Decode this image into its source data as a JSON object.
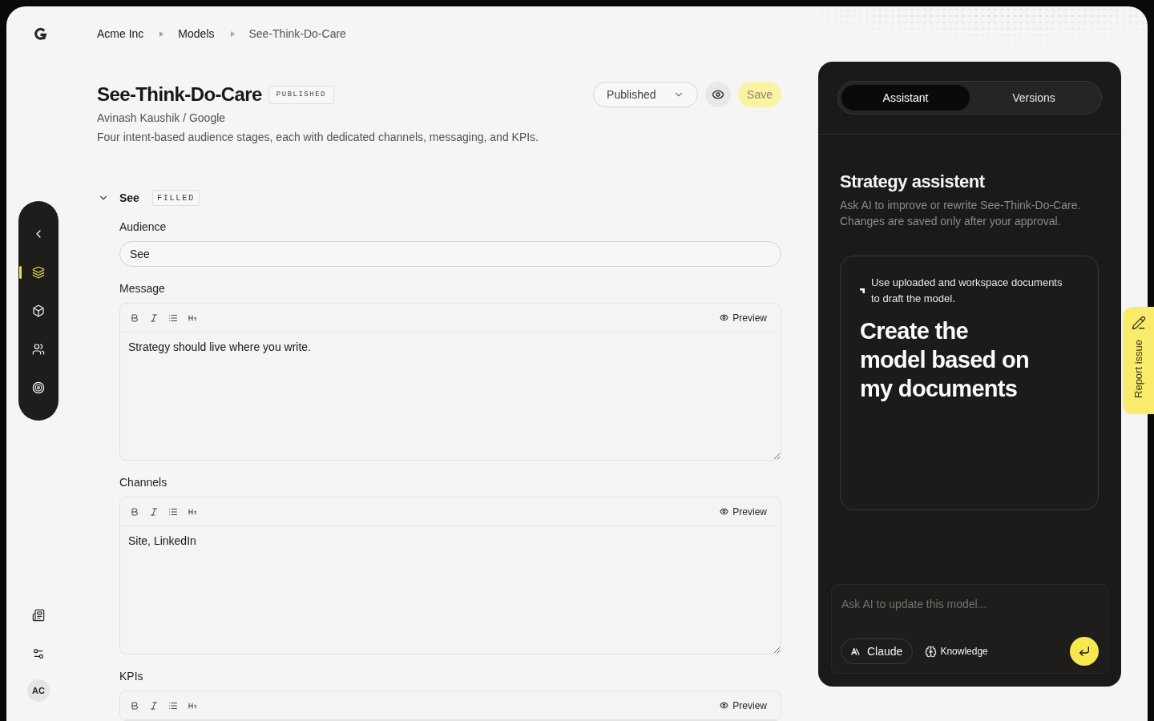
{
  "breadcrumb": [
    "Acme Inc",
    "Models",
    "See-Think-Do-Care"
  ],
  "model": {
    "title": "See-Think-Do-Care",
    "status_badge": "PUBLISHED",
    "author": "Avinash Kaushik / Google",
    "description": "Four intent-based audience stages, each with dedicated channels, messaging, and KPIs."
  },
  "actions": {
    "status_select": "Published",
    "save": {
      "label": "Save",
      "disabled": true
    }
  },
  "sidebar": {
    "nav_items": [
      {
        "selected": true
      },
      {
        "selected": false
      },
      {
        "selected": false
      },
      {
        "selected": false
      }
    ],
    "avatar": "AC"
  },
  "section": {
    "title": "See",
    "badge": "FILLED",
    "expanded": true,
    "fields": [
      {
        "kind": "input",
        "label": "Audience",
        "value": "See"
      },
      {
        "kind": "editor",
        "label": "Message",
        "preview": "Preview",
        "value": "Strategy should live where you write."
      },
      {
        "kind": "editor",
        "label": "Channels",
        "preview": "Preview",
        "value": "Site, LinkedIn"
      },
      {
        "kind": "editor",
        "label": "KPIs",
        "preview": "Preview"
      }
    ]
  },
  "assistant_panel": {
    "tabs": [
      {
        "label": "Assistant",
        "selected": true
      },
      {
        "label": "Versions",
        "selected": false
      }
    ],
    "title": "Strategy assistent",
    "description": "Ask AI to improve or rewrite See-Think-Do-Care. Changes are saved only after your approval.",
    "suggestion": {
      "hint": "Use uploaded and workspace documents to draft the model.",
      "title": "Create the model based on my documents"
    },
    "composer": {
      "placeholder": "Ask AI to update this model...",
      "model": "Claude",
      "knowledge": "Knowledge"
    }
  },
  "report_tab": {
    "label": "Report issue"
  }
}
